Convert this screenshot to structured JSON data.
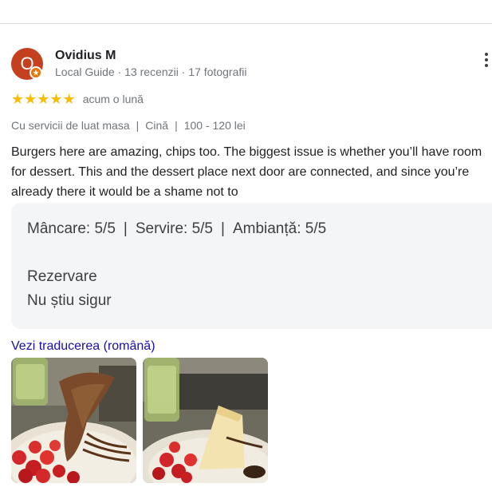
{
  "review": {
    "avatar_letter": "O",
    "author_name": "Ovidius M",
    "author_meta": "Local Guide · 13 recenzii · 17 fotografii",
    "stars": "★★★★★",
    "rating": 5,
    "date": "acum o lună",
    "tags": [
      "Cu servicii de luat masa",
      "Cină",
      "100 - 120 lei"
    ],
    "tag_separator": "|",
    "text": "Burgers here are amazing, chips too. The biggest issue is whether you’ll have room for dessert. This and the dessert place next door are connected, and since you’re already there it would be a shame not to",
    "attributes": [
      {
        "label": "Mâncare: 5/5"
      },
      {
        "label": "Servire: 5/5"
      },
      {
        "label": "Ambianță: 5/5"
      }
    ],
    "attr_separator": "|",
    "reservation_title": "Rezervare",
    "reservation_value": "Nu știu sigur",
    "translate_link": "Vezi traducerea (română)"
  },
  "colors": {
    "avatar": "#c5401e",
    "star": "#fbbc04",
    "link": "#1a0dab",
    "box": "#f4f5f7"
  },
  "icons": {
    "more": "more-vert-icon",
    "badge": "local-guide-badge-icon"
  }
}
